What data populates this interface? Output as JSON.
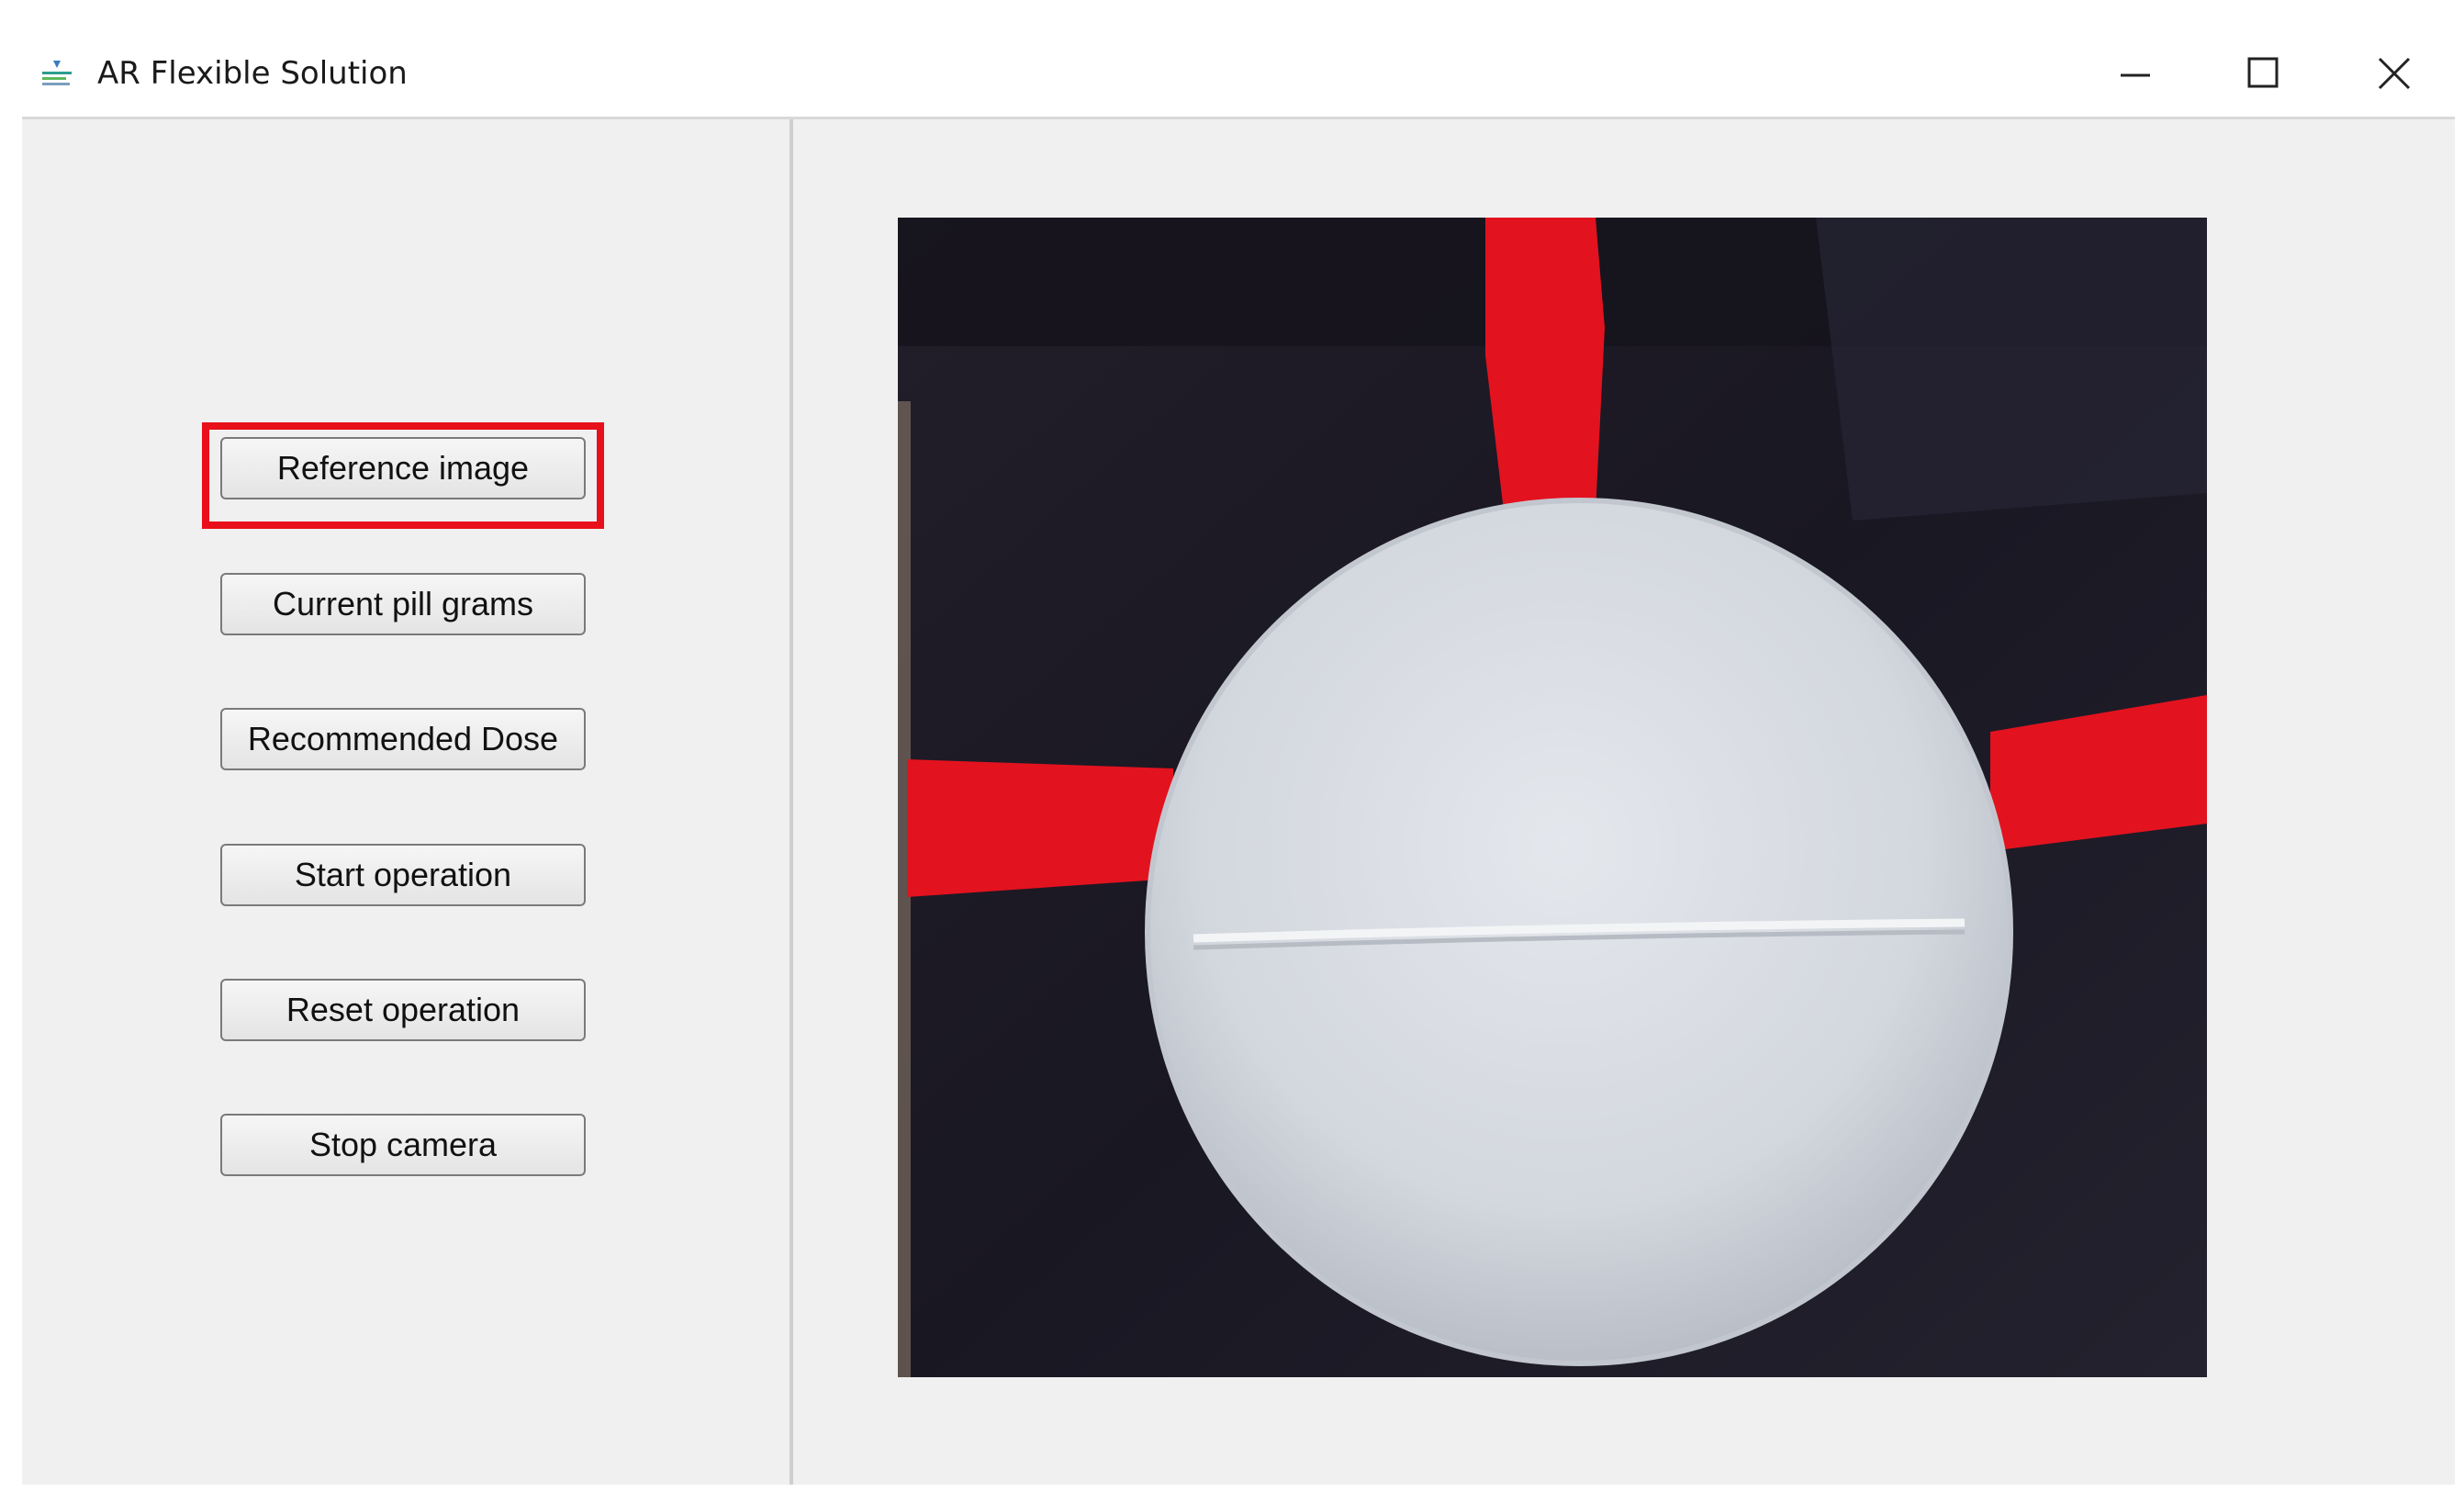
{
  "window": {
    "title": "AR Flexible Solution",
    "app_icon": "app-logo-icon",
    "controls": {
      "minimize_icon": "minimize-icon",
      "maximize_icon": "maximize-icon",
      "close_icon": "close-icon"
    }
  },
  "sidebar": {
    "buttons": [
      {
        "label": "Reference image",
        "highlighted": true
      },
      {
        "label": "Current pill grams",
        "highlighted": false
      },
      {
        "label": "Recommended Dose",
        "highlighted": false
      },
      {
        "label": "Start operation",
        "highlighted": false
      },
      {
        "label": "Reset operation",
        "highlighted": false
      },
      {
        "label": "Stop camera",
        "highlighted": false
      }
    ],
    "highlight_color": "#e8101a"
  },
  "camera": {
    "content": "pill-image",
    "colors": {
      "background": "#1d1b26",
      "marker_lines": "#e3121f",
      "pill": "#d9dde2"
    }
  }
}
